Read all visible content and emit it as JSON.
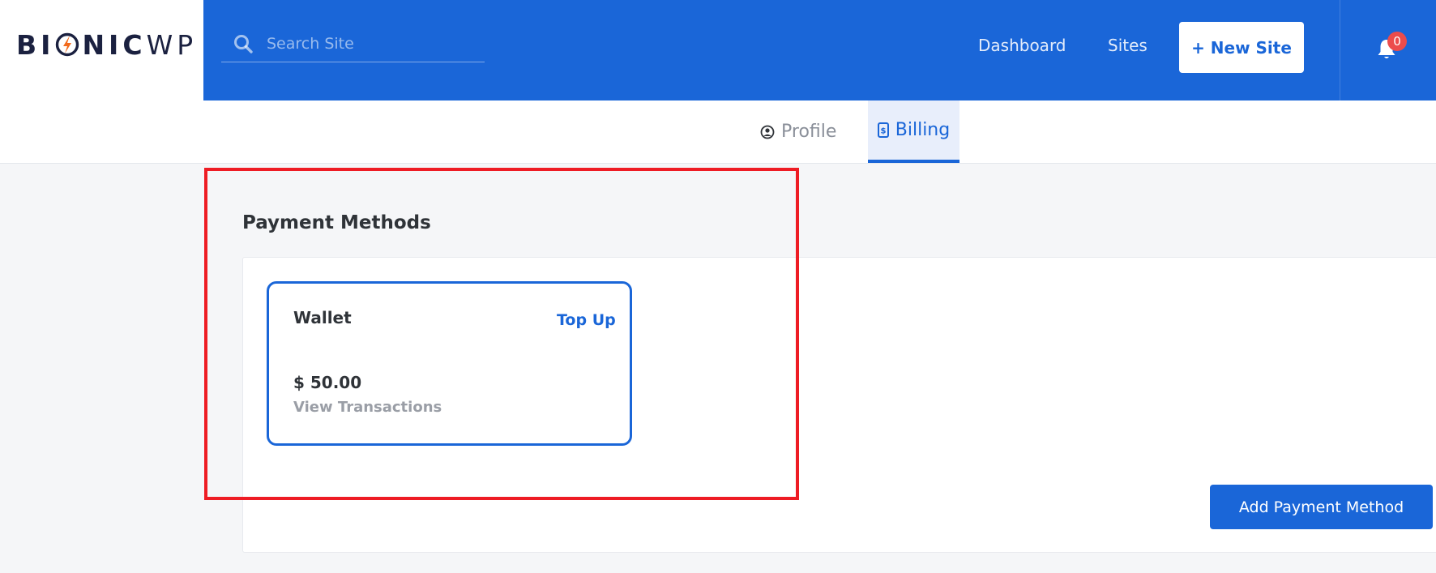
{
  "logo": {
    "prefix": "BI",
    "suffix_bold": "NIC",
    "suffix_light": "WP"
  },
  "search": {
    "placeholder": "Search Site",
    "value": ""
  },
  "nav": {
    "dashboard": "Dashboard",
    "sites": "Sites",
    "new_site": "+ New Site"
  },
  "notifications": {
    "count": "0"
  },
  "tabs": [
    {
      "label": "Profile",
      "icon": "user-circle-icon",
      "active": false
    },
    {
      "label": "Billing",
      "icon": "billing-icon",
      "active": true
    }
  ],
  "payment_methods": {
    "title": "Payment Methods",
    "wallet": {
      "title": "Wallet",
      "top_up": "Top Up",
      "amount": "$ 50.00",
      "view_transactions": "View Transactions"
    },
    "add_button": "Add Payment Method"
  },
  "colors": {
    "primary": "#1a66d8",
    "highlight": "#ee1c24",
    "badge": "#ec4c4c",
    "logo_accent": "#f26b1d"
  }
}
